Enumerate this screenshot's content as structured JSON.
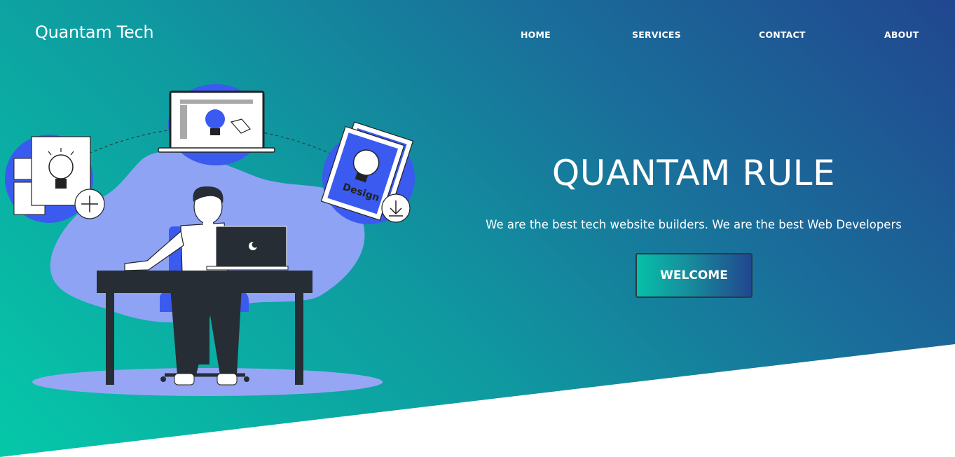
{
  "brand": {
    "name": "Quantam Tech"
  },
  "nav": {
    "items": [
      {
        "label": "HOME"
      },
      {
        "label": "SERVICES"
      },
      {
        "label": "CONTACT"
      },
      {
        "label": "ABOUT"
      }
    ]
  },
  "hero": {
    "headline": "QUANTAM RULE",
    "tagline": "We are the best tech website builders. We are the best Web Developers",
    "cta_label": "WELCOME",
    "illustration": {
      "poster_text": "Design"
    }
  },
  "colors": {
    "gradient_start": "#05c8a8",
    "gradient_end": "#21468f",
    "accent_blue": "#3a5af0",
    "blob_lavender": "#8fa3f5",
    "dark": "#262d34"
  }
}
